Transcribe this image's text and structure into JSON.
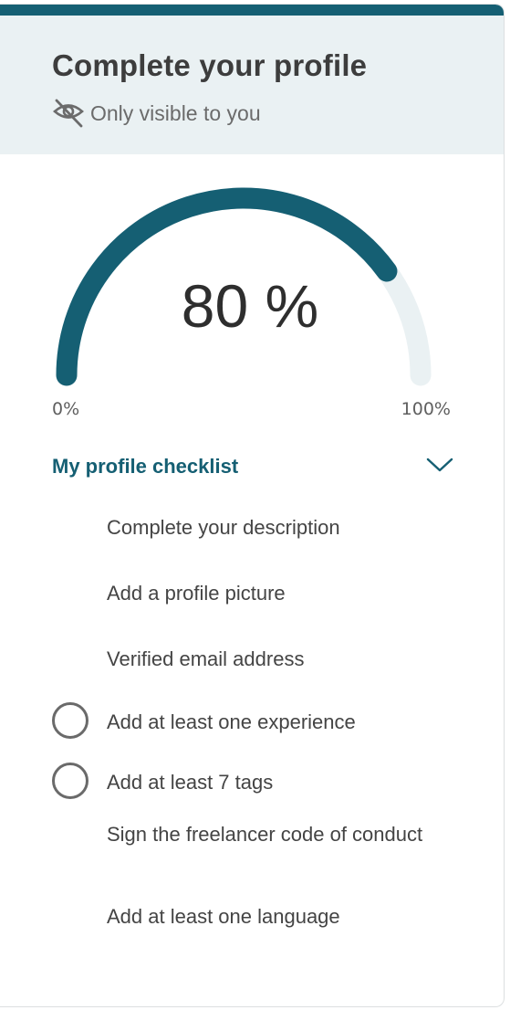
{
  "header": {
    "title": "Complete your profile",
    "visibility_note": "Only visible to you",
    "visibility_icon": "eye-slash-icon"
  },
  "progress": {
    "value_percent": 80,
    "label": "80 %",
    "min_label": "0%",
    "max_label": "100%",
    "track_color": "#eaf1f3",
    "fill_color": "#155f73"
  },
  "checklist": {
    "title": "My profile checklist",
    "toggle_icon": "chevron-down-icon",
    "items": [
      {
        "label": "Complete your description",
        "completed": true
      },
      {
        "label": "Add a profile picture",
        "completed": true
      },
      {
        "label": "Verified email address",
        "completed": true
      },
      {
        "label": "Add at least one experience",
        "completed": false
      },
      {
        "label": "Add at least 7 tags",
        "completed": false
      },
      {
        "label": "Sign the freelancer code of conduct",
        "completed": true
      },
      {
        "label": "Add at least one language",
        "completed": true
      }
    ]
  },
  "colors": {
    "accent": "#155f73",
    "header_bg": "#eaf1f3"
  }
}
